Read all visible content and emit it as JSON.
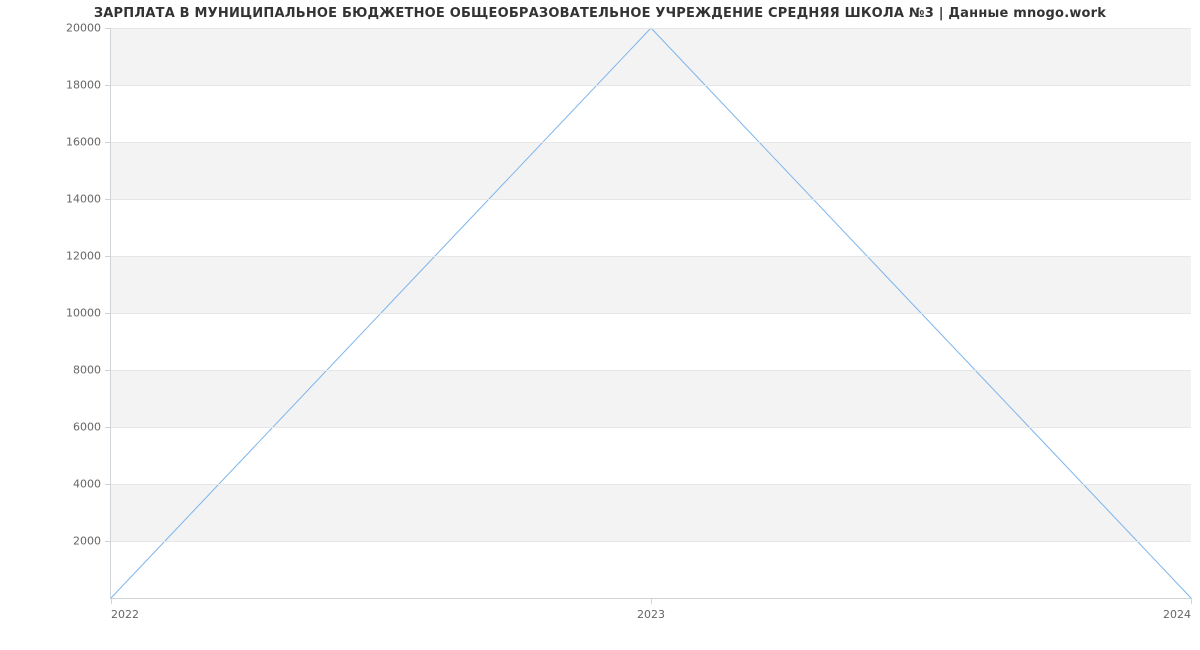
{
  "chart_data": {
    "type": "line",
    "title": "ЗАРПЛАТА В МУНИЦИПАЛЬНОЕ БЮДЖЕТНОЕ ОБЩЕОБРАЗОВАТЕЛЬНОЕ УЧРЕЖДЕНИЕ СРЕДНЯЯ ШКОЛА №3 | Данные mnogo.work",
    "xlabel": "",
    "ylabel": "",
    "x": [
      2022,
      2023,
      2024
    ],
    "values": [
      0,
      20000,
      0
    ],
    "y_ticks": [
      2000,
      4000,
      6000,
      8000,
      10000,
      12000,
      14000,
      16000,
      18000,
      20000
    ],
    "x_ticks": [
      2022,
      2023,
      2024
    ],
    "ylim": [
      0,
      20000
    ],
    "xlim": [
      2022,
      2024
    ],
    "colors": {
      "line": "#7cb5ec",
      "band": "#f3f3f3"
    }
  }
}
